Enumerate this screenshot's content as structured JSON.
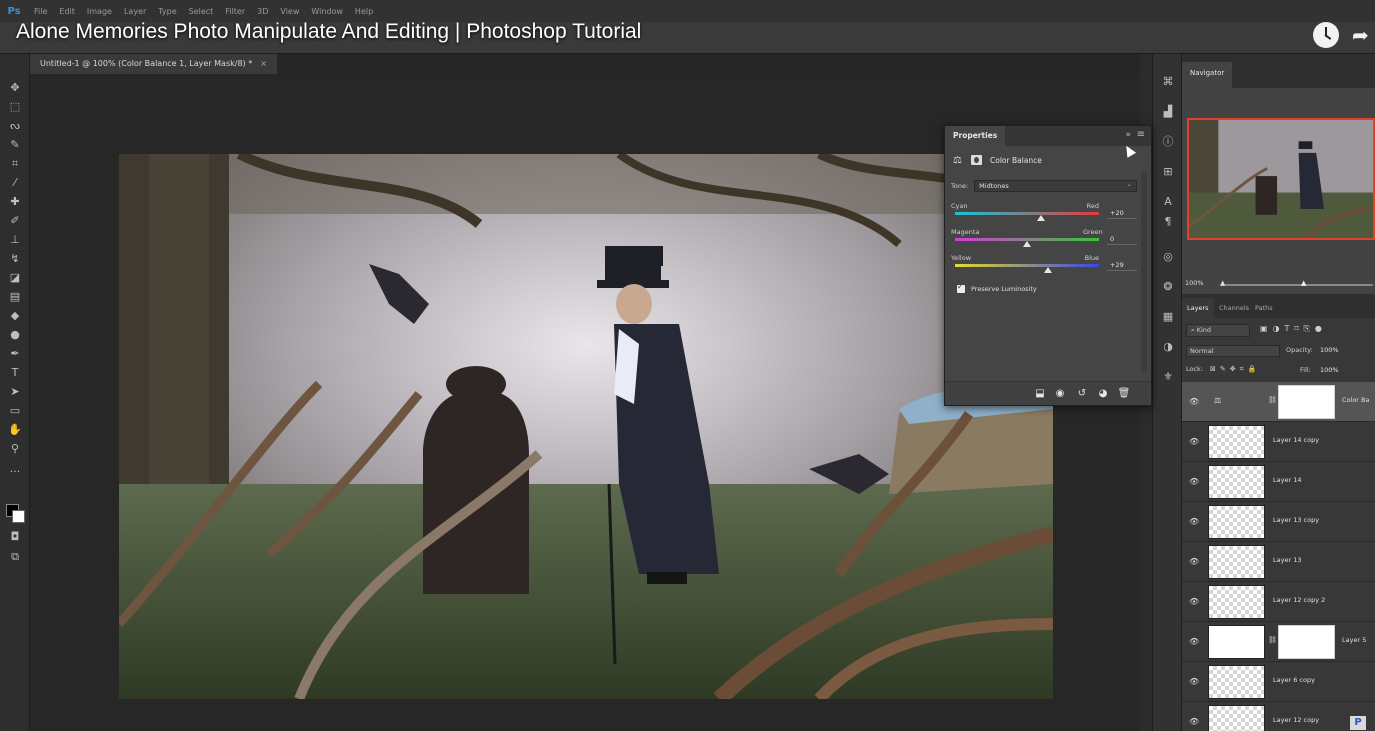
{
  "video": {
    "title": "Alone Memories Photo Manipulate And Editing | Photoshop Tutorial"
  },
  "menu": {
    "logo": "Ps",
    "items": [
      "File",
      "Edit",
      "Image",
      "Layer",
      "Type",
      "Select",
      "Filter",
      "3D",
      "View",
      "Window",
      "Help"
    ]
  },
  "document": {
    "tab_title": "Untitled-1 @ 100% (Color Balance 1, Layer Mask/8) *",
    "close_glyph": "×"
  },
  "properties": {
    "tab": "Properties",
    "collapse_glyph": "»",
    "menu_glyph": "≡",
    "adjustment": "Color Balance",
    "tone_label": "Tone:",
    "tone_value": "Midtones",
    "sliders": [
      {
        "left": "Cyan",
        "right": "Red",
        "value": "+20",
        "level": 0.6
      },
      {
        "left": "Magenta",
        "right": "Green",
        "value": "0",
        "level": 0.5
      },
      {
        "left": "Yellow",
        "right": "Blue",
        "value": "+29",
        "level": 0.645
      }
    ],
    "preserve_label": "Preserve Luminosity",
    "preserve_checked": true
  },
  "navigator": {
    "tab": "Navigator",
    "zoom": "100%"
  },
  "layers_panel": {
    "tabs": [
      "Layers",
      "Channels",
      "Paths"
    ],
    "kind": "Kind",
    "blend_mode": "Normal",
    "opacity_label": "Opacity:",
    "opacity_value": "100%",
    "lock_label": "Lock:",
    "fill_label": "Fill:",
    "fill_value": "100%",
    "layers": [
      {
        "name": "Color Ba",
        "type": "adjustment",
        "selected": true
      },
      {
        "name": "Layer 14 copy"
      },
      {
        "name": "Layer 14"
      },
      {
        "name": "Layer 13 copy"
      },
      {
        "name": "Layer 13"
      },
      {
        "name": "Layer 12 copy 2"
      },
      {
        "name": "Layer 5",
        "type": "masked"
      },
      {
        "name": "Layer 6 copy"
      },
      {
        "name": "Layer 12 copy"
      }
    ]
  },
  "watermark_badge": "P",
  "colors": {
    "accent_navigator_frame": "#e0412b",
    "panel_bg": "#454545",
    "app_bg": "#2b2b2b"
  }
}
